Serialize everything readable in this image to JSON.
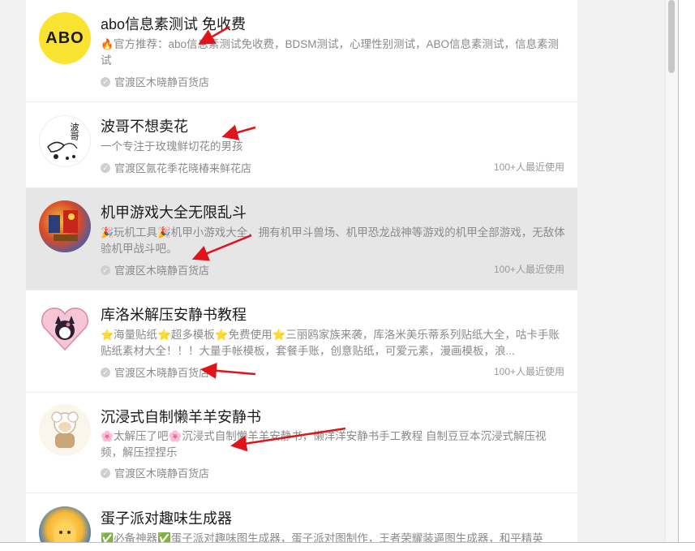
{
  "items": [
    {
      "title": "abo信息素测试 免收费",
      "badge": "🔥",
      "desc": "官方推荐：abo信息素测试免收费，BDSM测试，心理性别测试，ABO信息素测试，信息素测试",
      "store": "官渡区木晓静百货店",
      "usage": "",
      "avatar_text": "ABO"
    },
    {
      "title": "波哥不想卖花",
      "badge": "",
      "desc": "一个专注于玫瑰鲜切花的男孩",
      "store": "官渡区氤花季花晓椿来鲜花店",
      "usage": "100+人最近使用",
      "avatar_text": "波哥"
    },
    {
      "title": "机甲游戏大全无限乱斗",
      "badge": "🎉",
      "desc": "玩机工具🎉机甲小游戏大全，拥有机甲斗兽场、机甲恐龙战神等游戏的机甲全部游戏，无敌体验机甲战斗吧。",
      "store": "官渡区木晓静百货店",
      "usage": "100+人最近使用",
      "avatar_text": ""
    },
    {
      "title": "库洛米解压安静书教程",
      "badge": "⭐",
      "desc": "海量贴纸⭐超多模板⭐免费使用⭐三丽鸥家族来袭，库洛米美乐蒂系列贴纸大全，咕卡手账贴纸素材大全！！！大量手帐模板，套餐手账，创意贴纸，可爱元素，漫画模板，浪...",
      "store": "官渡区木晓静百货店",
      "usage": "100+人最近使用",
      "avatar_text": ""
    },
    {
      "title": "沉浸式自制懒羊羊安静书",
      "badge": "🌸",
      "desc": "太解压了吧🌸沉浸式自制懒羊羊安静书，懒洋洋安静书手工教程 自制豆豆本沉浸式解压视频，解压捏捏乐",
      "store": "官渡区木晓静百货店",
      "usage": "",
      "avatar_text": ""
    },
    {
      "title": "蛋子派对趣味生成器",
      "badge": "✅",
      "desc": "必备神器✅蛋子派对趣味图生成器，蛋子派对图制作，王者荣耀装逼图生成器，和平精英",
      "store": "",
      "usage": "",
      "avatar_text": ""
    }
  ],
  "colors": {
    "arrow": "#e0141a",
    "highlight_row": "#e6e6e6",
    "abo_yellow": "#fbe431"
  }
}
